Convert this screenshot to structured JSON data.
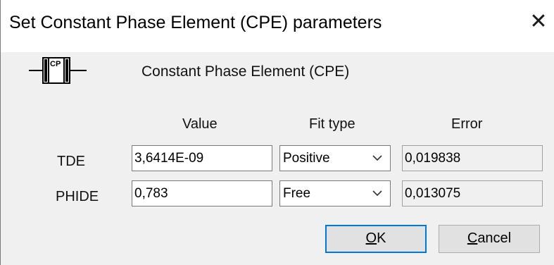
{
  "window": {
    "title": "Set Constant Phase Element (CPE) parameters",
    "close_glyph": "✕"
  },
  "element": {
    "icon": "cpe-element-icon",
    "icon_label": "CP",
    "heading": "Constant Phase Element (CPE)"
  },
  "columns": {
    "value": "Value",
    "fit_type": "Fit type",
    "error": "Error"
  },
  "params": [
    {
      "name": "TDE",
      "value": "3,6414E-09",
      "fit_type": "Positive",
      "error": "0,019838"
    },
    {
      "name": "PHIDE",
      "value": "0,783",
      "fit_type": "Free",
      "error": "0,013075"
    }
  ],
  "buttons": {
    "ok": {
      "accel": "O",
      "rest": "K"
    },
    "cancel": {
      "accel": "C",
      "rest": "ancel"
    }
  },
  "colors": {
    "dialog_bg": "#f0f0f0",
    "focus_border": "#0078d7"
  }
}
